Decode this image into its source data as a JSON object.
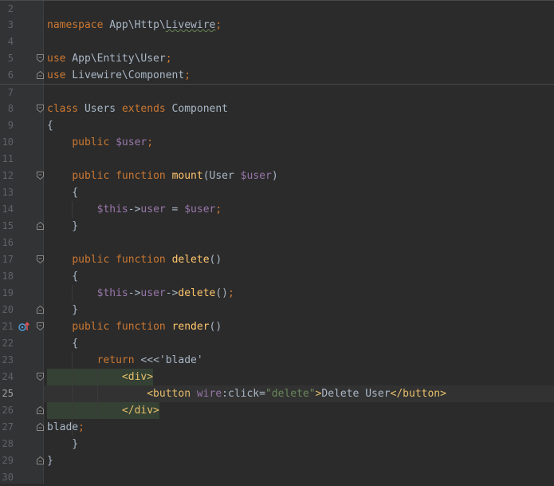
{
  "editor": {
    "caret_line": "25",
    "lines": [
      {
        "n": "2",
        "code": []
      },
      {
        "n": "3",
        "code": [
          {
            "t": "namespace",
            "c": "kw"
          },
          {
            "t": " App\\Http\\",
            "c": "plain"
          },
          {
            "t": "Livewire",
            "c": "plain squig"
          },
          {
            "t": ";",
            "c": "kw"
          }
        ]
      },
      {
        "n": "4",
        "code": []
      },
      {
        "n": "5",
        "fold": "open",
        "code": [
          {
            "t": "use",
            "c": "kw"
          },
          {
            "t": " App\\Entity\\User",
            "c": "plain"
          },
          {
            "t": ";",
            "c": "kw"
          }
        ]
      },
      {
        "n": "6",
        "fold": "close",
        "code": [
          {
            "t": "use",
            "c": "kw"
          },
          {
            "t": " Livewire\\Component",
            "c": "plain"
          },
          {
            "t": ";",
            "c": "kw"
          }
        ]
      },
      {
        "n": "7",
        "code": []
      },
      {
        "n": "8",
        "fold": "open",
        "code": [
          {
            "t": "class",
            "c": "kw"
          },
          {
            "t": " Users ",
            "c": "plain"
          },
          {
            "t": "extends",
            "c": "kw"
          },
          {
            "t": " Component",
            "c": "plain"
          }
        ]
      },
      {
        "n": "9",
        "code": [
          {
            "t": "{",
            "c": "plain"
          }
        ]
      },
      {
        "n": "10",
        "code": [
          {
            "t": "    ",
            "c": "plain"
          },
          {
            "t": "public",
            "c": "kw"
          },
          {
            "t": " ",
            "c": "plain"
          },
          {
            "t": "$user",
            "c": "var"
          },
          {
            "t": ";",
            "c": "kw"
          }
        ]
      },
      {
        "n": "11",
        "code": []
      },
      {
        "n": "12",
        "fold": "open",
        "code": [
          {
            "t": "    ",
            "c": "plain"
          },
          {
            "t": "public",
            "c": "kw"
          },
          {
            "t": " ",
            "c": "plain"
          },
          {
            "t": "function",
            "c": "kw"
          },
          {
            "t": " ",
            "c": "plain"
          },
          {
            "t": "mount",
            "c": "fn"
          },
          {
            "t": "(User ",
            "c": "plain"
          },
          {
            "t": "$user",
            "c": "var"
          },
          {
            "t": ")",
            "c": "plain"
          }
        ]
      },
      {
        "n": "13",
        "code": [
          {
            "t": "    {",
            "c": "plain"
          }
        ]
      },
      {
        "n": "14",
        "code": [
          {
            "t": "        ",
            "c": "plain"
          },
          {
            "t": "$this",
            "c": "var"
          },
          {
            "t": "->",
            "c": "plain"
          },
          {
            "t": "user",
            "c": "var"
          },
          {
            "t": " = ",
            "c": "plain"
          },
          {
            "t": "$user",
            "c": "var"
          },
          {
            "t": ";",
            "c": "kw"
          }
        ]
      },
      {
        "n": "15",
        "fold": "close",
        "code": [
          {
            "t": "    }",
            "c": "plain"
          }
        ]
      },
      {
        "n": "16",
        "code": []
      },
      {
        "n": "17",
        "fold": "open",
        "code": [
          {
            "t": "    ",
            "c": "plain"
          },
          {
            "t": "public",
            "c": "kw"
          },
          {
            "t": " ",
            "c": "plain"
          },
          {
            "t": "function",
            "c": "kw"
          },
          {
            "t": " ",
            "c": "plain"
          },
          {
            "t": "delete",
            "c": "fn"
          },
          {
            "t": "()",
            "c": "plain"
          }
        ]
      },
      {
        "n": "18",
        "code": [
          {
            "t": "    {",
            "c": "plain"
          }
        ]
      },
      {
        "n": "19",
        "code": [
          {
            "t": "        ",
            "c": "plain"
          },
          {
            "t": "$this",
            "c": "var"
          },
          {
            "t": "->",
            "c": "plain"
          },
          {
            "t": "user",
            "c": "var"
          },
          {
            "t": "->",
            "c": "plain"
          },
          {
            "t": "delete",
            "c": "fn"
          },
          {
            "t": "()",
            "c": "plain"
          },
          {
            "t": ";",
            "c": "kw"
          }
        ]
      },
      {
        "n": "20",
        "fold": "close",
        "code": [
          {
            "t": "    }",
            "c": "plain"
          }
        ]
      },
      {
        "n": "21",
        "fold": "open",
        "icon": "override-method-icon",
        "code": [
          {
            "t": "    ",
            "c": "plain"
          },
          {
            "t": "public",
            "c": "kw"
          },
          {
            "t": " ",
            "c": "plain"
          },
          {
            "t": "function",
            "c": "kw"
          },
          {
            "t": " ",
            "c": "plain"
          },
          {
            "t": "render",
            "c": "fn"
          },
          {
            "t": "()",
            "c": "plain"
          }
        ]
      },
      {
        "n": "22",
        "code": [
          {
            "t": "    {",
            "c": "plain"
          }
        ]
      },
      {
        "n": "23",
        "code": [
          {
            "t": "        ",
            "c": "plain"
          },
          {
            "t": "return",
            "c": "kw"
          },
          {
            "t": " <<<'blade'",
            "c": "plain"
          }
        ]
      },
      {
        "n": "24",
        "fold": "open",
        "hl": true,
        "code": [
          {
            "t": "            ",
            "c": "plain"
          },
          {
            "t": "<div>",
            "c": "tag"
          }
        ]
      },
      {
        "n": "25",
        "code": [
          {
            "t": "                ",
            "c": "plain"
          },
          {
            "t": "<button ",
            "c": "tag"
          },
          {
            "t": "wire",
            "c": "var"
          },
          {
            "t": ":click=",
            "c": "plain"
          },
          {
            "t": "\"delete\"",
            "c": "str"
          },
          {
            "t": ">",
            "c": "tag"
          },
          {
            "t": "Delete User",
            "c": "plain"
          },
          {
            "t": "</button>",
            "c": "tag"
          }
        ]
      },
      {
        "n": "26",
        "fold": "close",
        "hl": true,
        "code": [
          {
            "t": "            ",
            "c": "plain"
          },
          {
            "t": "</div>",
            "c": "tag"
          }
        ]
      },
      {
        "n": "27",
        "fold": "close",
        "code": [
          {
            "t": "blade",
            "c": "plain"
          },
          {
            "t": ";",
            "c": "kw"
          }
        ]
      },
      {
        "n": "28",
        "code": [
          {
            "t": "    }",
            "c": "plain"
          }
        ]
      },
      {
        "n": "29",
        "fold": "close",
        "code": [
          {
            "t": "}",
            "c": "plain"
          }
        ]
      },
      {
        "n": "30",
        "code": []
      }
    ]
  }
}
